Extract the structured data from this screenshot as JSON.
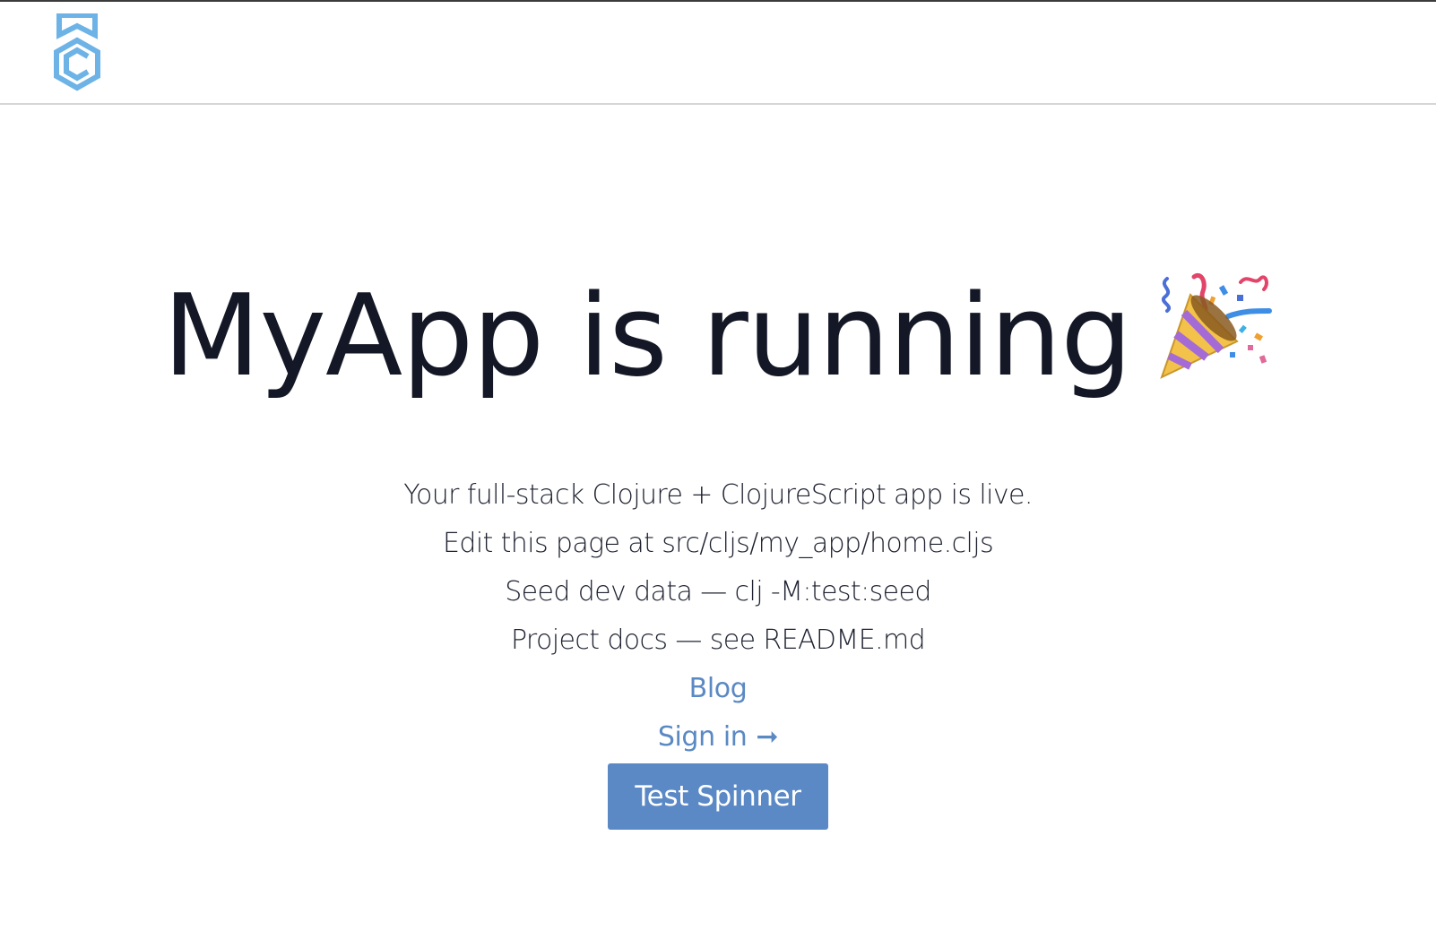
{
  "header": {
    "logo_icon": "shield-c-logo-icon",
    "logo_color": "#6db3e6"
  },
  "hero": {
    "title": "MyApp is running",
    "emoji_icon": "party-popper-icon"
  },
  "info": {
    "lines": [
      "Your full-stack Clojure + ClojureScript app is live.",
      "Edit this page at src/cljs/my_app/home.cljs",
      "Seed dev data — clj -M:test:seed",
      "Project docs — see README.md"
    ],
    "blog_link": "Blog",
    "signin_link": "Sign in",
    "signin_arrow": "➞",
    "button_label": "Test Spinner"
  },
  "colors": {
    "link": "#5a89c3",
    "button": "#5b89c6",
    "title": "#141826"
  }
}
